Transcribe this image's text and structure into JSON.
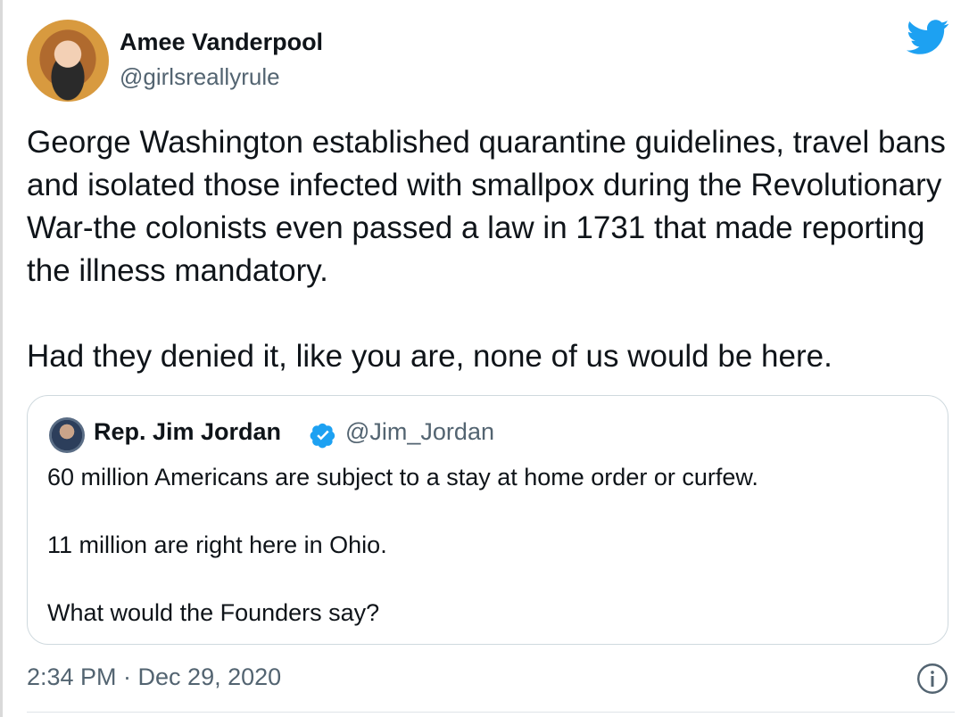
{
  "author": {
    "display_name": "Amee Vanderpool",
    "handle": "@girlsreallyrule",
    "avatar_icon": "profile-photo"
  },
  "brand": {
    "icon": "twitter-bird-icon",
    "color": "#1DA1F2"
  },
  "tweet": {
    "text": "George Washington established quarantine guidelines, travel bans and isolated those infected with smallpox during the Revolutionary War-the colonists even passed a law in 1731 that made reporting the illness mandatory.\n\nHad they denied it, like you are, none of us would be here."
  },
  "quoted_tweet": {
    "display_name": "Rep. Jim Jordan",
    "verified_icon": "verified-badge-icon",
    "handle": "@Jim_Jordan",
    "text": "60 million Americans are subject to a stay at home order or curfew.\n\n11 million are right here in Ohio.\n\nWhat would the Founders say?"
  },
  "meta": {
    "timestamp": "2:34 PM · Dec 29, 2020",
    "info_icon": "info-icon"
  },
  "colors": {
    "text": "#0f1419",
    "secondary": "#536471",
    "accent": "#1DA1F2",
    "border": "#cfd9de"
  }
}
